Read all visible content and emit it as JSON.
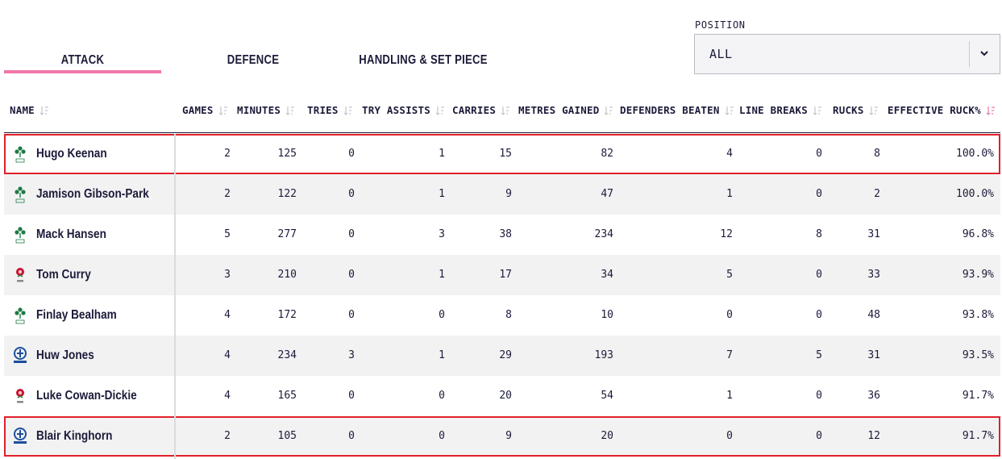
{
  "tabs": [
    {
      "label": "ATTACK",
      "active": true
    },
    {
      "label": "DEFENCE",
      "active": false
    },
    {
      "label": "HANDLING & SET PIECE",
      "active": false
    }
  ],
  "position_filter": {
    "label": "POSITION",
    "value": "ALL"
  },
  "columns": [
    "NAME",
    "GAMES",
    "MINUTES",
    "TRIES",
    "TRY ASSISTS",
    "CARRIES",
    "METRES GAINED",
    "DEFENDERS BEATEN",
    "LINE BREAKS",
    "RUCKS",
    "EFFECTIVE RUCK%"
  ],
  "sorted_column": "EFFECTIVE RUCK%",
  "colors": {
    "accent": "#f077a8",
    "highlight": "#e0202a",
    "ireland": "#1f7a45",
    "scotland": "#1d4f9c",
    "england": "#c8102e"
  },
  "rows": [
    {
      "crest": "ireland-crest-icon",
      "name": "Hugo Keenan",
      "games": "2",
      "minutes": "125",
      "tries": "0",
      "try_assists": "1",
      "carries": "15",
      "metres_gained": "82",
      "defenders_beaten": "4",
      "line_breaks": "0",
      "rucks": "8",
      "effective_ruck": "100.0%",
      "highlighted": true
    },
    {
      "crest": "ireland-crest-icon",
      "name": "Jamison Gibson-Park",
      "games": "2",
      "minutes": "122",
      "tries": "0",
      "try_assists": "1",
      "carries": "9",
      "metres_gained": "47",
      "defenders_beaten": "1",
      "line_breaks": "0",
      "rucks": "2",
      "effective_ruck": "100.0%",
      "highlighted": false
    },
    {
      "crest": "ireland-crest-icon",
      "name": "Mack Hansen",
      "games": "5",
      "minutes": "277",
      "tries": "0",
      "try_assists": "3",
      "carries": "38",
      "metres_gained": "234",
      "defenders_beaten": "12",
      "line_breaks": "8",
      "rucks": "31",
      "effective_ruck": "96.8%",
      "highlighted": false
    },
    {
      "crest": "england-rose-icon",
      "name": "Tom Curry",
      "games": "3",
      "minutes": "210",
      "tries": "0",
      "try_assists": "1",
      "carries": "17",
      "metres_gained": "34",
      "defenders_beaten": "5",
      "line_breaks": "0",
      "rucks": "33",
      "effective_ruck": "93.9%",
      "highlighted": false
    },
    {
      "crest": "ireland-crest-icon",
      "name": "Finlay Bealham",
      "games": "4",
      "minutes": "172",
      "tries": "0",
      "try_assists": "0",
      "carries": "8",
      "metres_gained": "10",
      "defenders_beaten": "0",
      "line_breaks": "0",
      "rucks": "48",
      "effective_ruck": "93.8%",
      "highlighted": false
    },
    {
      "crest": "scotland-thistle-icon",
      "name": "Huw Jones",
      "games": "4",
      "minutes": "234",
      "tries": "3",
      "try_assists": "1",
      "carries": "29",
      "metres_gained": "193",
      "defenders_beaten": "7",
      "line_breaks": "5",
      "rucks": "31",
      "effective_ruck": "93.5%",
      "highlighted": false
    },
    {
      "crest": "england-rose-icon",
      "name": "Luke Cowan-Dickie",
      "games": "4",
      "minutes": "165",
      "tries": "0",
      "try_assists": "0",
      "carries": "20",
      "metres_gained": "54",
      "defenders_beaten": "1",
      "line_breaks": "0",
      "rucks": "36",
      "effective_ruck": "91.7%",
      "highlighted": false
    },
    {
      "crest": "scotland-thistle-icon",
      "name": "Blair Kinghorn",
      "games": "2",
      "minutes": "105",
      "tries": "0",
      "try_assists": "0",
      "carries": "9",
      "metres_gained": "20",
      "defenders_beaten": "0",
      "line_breaks": "0",
      "rucks": "12",
      "effective_ruck": "91.7%",
      "highlighted": true
    }
  ]
}
